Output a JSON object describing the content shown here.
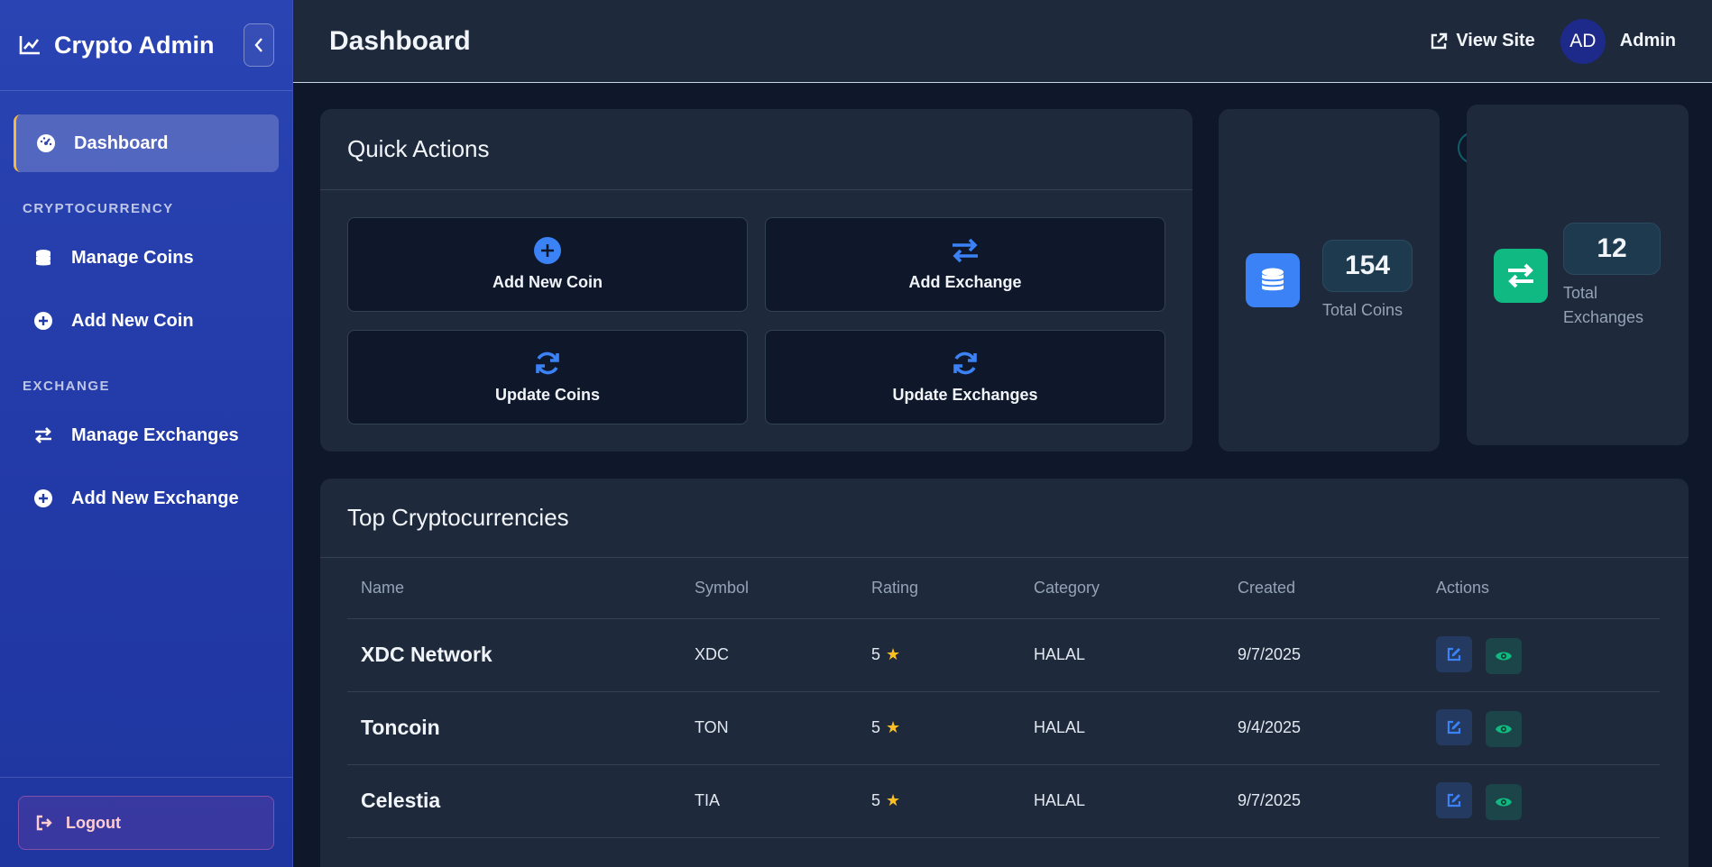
{
  "brand": {
    "title": "Crypto Admin"
  },
  "sidebar": {
    "dashboard": "Dashboard",
    "section_crypto": "CRYPTOCURRENCY",
    "manage_coins": "Manage Coins",
    "add_coin": "Add New Coin",
    "section_exchange": "EXCHANGE",
    "manage_exchanges": "Manage Exchanges",
    "add_exchange": "Add New Exchange",
    "logout": "Logout"
  },
  "topbar": {
    "title": "Dashboard",
    "view_site": "View Site",
    "avatar_initials": "AD",
    "user": "Admin"
  },
  "quick_actions": {
    "title": "Quick Actions",
    "add_coin": "Add New Coin",
    "add_exchange": "Add Exchange",
    "update_coins": "Update Coins",
    "update_exchanges": "Update Exchanges"
  },
  "stats": {
    "coins": {
      "value": "154",
      "label": "Total Coins"
    },
    "exchanges": {
      "value": "12",
      "label_line1": "Total",
      "label_line2": "Exchanges"
    }
  },
  "top_crypto": {
    "title": "Top Cryptocurrencies",
    "columns": {
      "name": "Name",
      "symbol": "Symbol",
      "rating": "Rating",
      "category": "Category",
      "created": "Created",
      "actions": "Actions"
    },
    "rows": [
      {
        "name": "XDC Network",
        "symbol": "XDC",
        "rating": "5",
        "category": "HALAL",
        "created": "9/7/2025"
      },
      {
        "name": "Toncoin",
        "symbol": "TON",
        "rating": "5",
        "category": "HALAL",
        "created": "9/4/2025"
      },
      {
        "name": "Celestia",
        "symbol": "TIA",
        "rating": "5",
        "category": "HALAL",
        "created": "9/7/2025"
      }
    ]
  },
  "colors": {
    "accent": "#3b82f6",
    "success": "#10b981",
    "sidebar": "#233ba8"
  }
}
